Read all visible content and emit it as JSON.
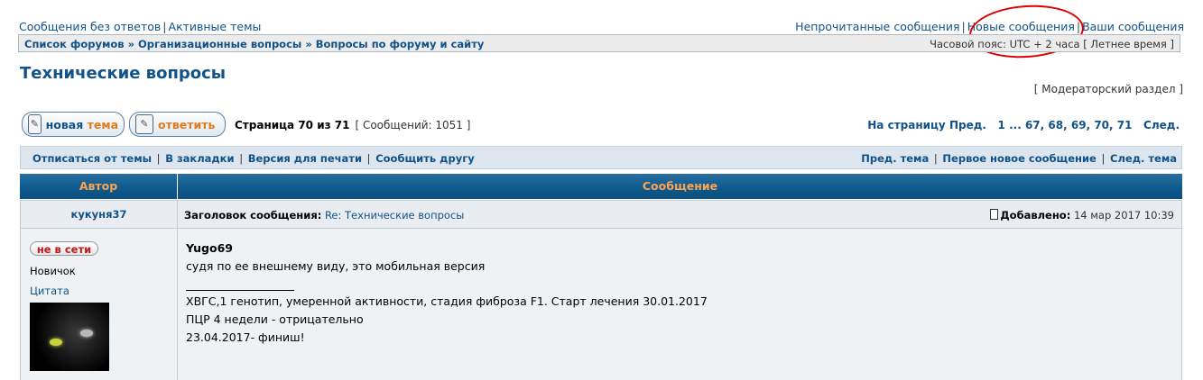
{
  "top_links": {
    "left": [
      "Сообщения без ответов",
      "Активные темы"
    ],
    "right": [
      "Непрочитанные сообщения",
      "Новые сообщения",
      "Ваши сообщения"
    ]
  },
  "breadcrumb": {
    "items": [
      "Список форумов",
      "Организационные вопросы",
      "Вопросы по форуму и сайту"
    ],
    "timezone": "Часовой пояс: UTC + 2 часа [ Летнее время ]"
  },
  "topic": {
    "title": "Технические вопросы",
    "moderator_link": "[ Модераторский раздел ]"
  },
  "buttons": {
    "new_topic_word1": "новая",
    "new_topic_word2": "тема",
    "reply": "ответить"
  },
  "pagination": {
    "page_text": "Страница 70 из 71",
    "count_text": "[ Сообщений: 1051 ]",
    "goto_label": "На страницу",
    "prev": "Пред.",
    "pages": [
      "1",
      "...",
      "67,",
      "68,",
      "69,",
      "70,",
      "71"
    ],
    "next": "След."
  },
  "actions": {
    "left": [
      "Отписаться от темы",
      "В закладки",
      "Версия для печати",
      "Сообщить другу"
    ],
    "right": [
      "Пред. тема",
      "Первое новое сообщение",
      "След. тема"
    ]
  },
  "table_header": {
    "author": "Автор",
    "message": "Сообщение"
  },
  "post": {
    "author": "кукуня37",
    "subject_label": "Заголовок сообщения:",
    "subject": "Re: Технические вопросы",
    "added_label": "Добавлено:",
    "added_time": "14 мар 2017 10:39",
    "status": "не в сети",
    "rank": "Новичок",
    "quote_link": "Цитата",
    "quoted_author": "Yugo69",
    "body": "судя по ее внешнему виду, это мобильная версия",
    "signature": [
      "ХВГС,1 генотип, умеренной активности, стадия фиброза F1. Старт лечения 30.01.2017",
      "ПЦР 4 недели - отрицательно",
      "23.04.2017- финиш!"
    ]
  },
  "colors": {
    "link": "#105289",
    "header_orange": "#ffa34f",
    "annotation_red": "#e00000"
  }
}
